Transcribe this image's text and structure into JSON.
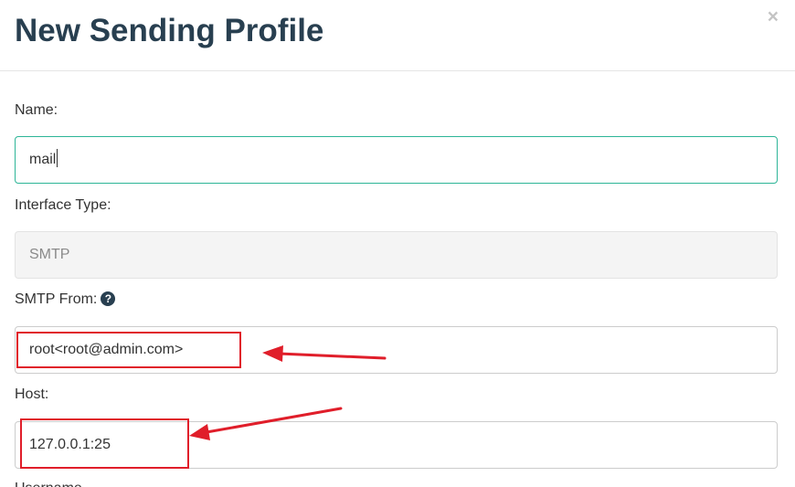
{
  "modal": {
    "title": "New Sending Profile",
    "close_label": "×"
  },
  "form": {
    "name": {
      "label": "Name:",
      "value": "mail"
    },
    "interface_type": {
      "label": "Interface Type:",
      "value": "SMTP"
    },
    "smtp_from": {
      "label": "SMTP From:",
      "help_icon": "question-circle-icon",
      "value": "root<root@admin.com>"
    },
    "host": {
      "label": "Host:",
      "value": "127.0.0.1:25"
    },
    "username": {
      "label": "Username"
    }
  },
  "annotations": {
    "color": "#e01e2a"
  }
}
